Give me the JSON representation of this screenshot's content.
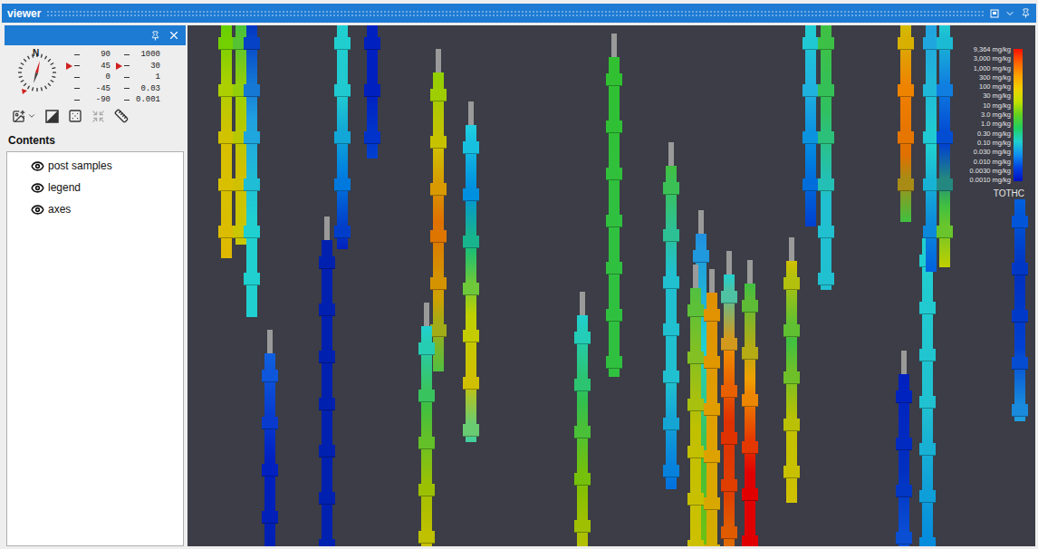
{
  "window": {
    "title": "viewer"
  },
  "panel": {
    "contents_label": "Contents"
  },
  "compass": {
    "north": "N"
  },
  "dip_scale": [
    {
      "label": "90",
      "marker": false
    },
    {
      "label": "45",
      "marker": true
    },
    {
      "label": "0",
      "marker": false
    },
    {
      "label": "-45",
      "marker": false
    },
    {
      "label": "-90",
      "marker": false
    }
  ],
  "value_scale": [
    {
      "label": "1000",
      "marker": false
    },
    {
      "label": "30",
      "marker": true
    },
    {
      "label": "1",
      "marker": false
    },
    {
      "label": "0.03",
      "marker": false
    },
    {
      "label": "0.001",
      "marker": false
    }
  ],
  "contents": [
    {
      "label": "post samples",
      "visible": true
    },
    {
      "label": "legend",
      "visible": true
    },
    {
      "label": "axes",
      "visible": true
    }
  ],
  "legend": {
    "title": "TOTHC",
    "labels": [
      "9,364 mg/kg",
      "3,000 mg/kg",
      "1,000 mg/kg",
      "300 mg/kg",
      "100 mg/kg",
      "30 mg/kg",
      "10 mg/kg",
      "3.0 mg/kg",
      "1.0 mg/kg",
      "0.30 mg/kg",
      "0.10 mg/kg",
      "0.030 mg/kg",
      "0.010 mg/kg",
      "0.0030 mg/kg",
      "0.0010 mg/kg"
    ],
    "colors": [
      "#ff1000",
      "#ff6000",
      "#ffa000",
      "#f0d000",
      "#c0e000",
      "#60d020",
      "#20d060",
      "#20d0d0",
      "#1090f0",
      "#0040e0",
      "#0010c0"
    ]
  },
  "holes": [
    {
      "collar": false,
      "colors": [
        "#5fd000",
        "#a8d000",
        "#d8c000",
        "#d8c000",
        "#e0b800"
      ]
    },
    {
      "collar": false,
      "colors": [
        "#40c040",
        "#a0d000",
        "#d0c000",
        "#c8c800"
      ]
    },
    {
      "collar": false,
      "colors": [
        "#0030c0",
        "#20a0e0",
        "#20d0d0",
        "#20d0d0"
      ]
    },
    {
      "collar": false,
      "colors": [
        "#20d0d0",
        "#20c8d0",
        "#0080e0",
        "#0020c0"
      ]
    },
    {
      "collar": false,
      "colors": [
        "#0020c0",
        "#0020c0",
        "#0040d0"
      ]
    },
    {
      "collar": true,
      "colors": [
        "#0020b0",
        "#0020b0"
      ]
    },
    {
      "collar": true,
      "colors": [
        "#1060e0",
        "#0020c0",
        "#0020b0"
      ]
    },
    {
      "collar": true,
      "colors": [
        "#90d000",
        "#d0c000",
        "#e07000",
        "#d0a000",
        "#50c040"
      ]
    },
    {
      "collar": true,
      "colors": [
        "#20d0e0",
        "#0090e0",
        "#20c070",
        "#c0d000",
        "#d0c000",
        "#40d0a0"
      ]
    },
    {
      "collar": true,
      "colors": [
        "#20d0d0",
        "#40c040",
        "#a0c000",
        "#d8c000"
      ]
    },
    {
      "collar": true,
      "colors": [
        "#30c030",
        "#30c040",
        "#30c040"
      ]
    },
    {
      "collar": true,
      "colors": [
        "#20d0d0",
        "#30c050",
        "#80c000",
        "#c8c000"
      ]
    },
    {
      "collar": true,
      "colors": [
        "#40c040",
        "#20c0d0",
        "#20c0d0",
        "#0070e0"
      ]
    },
    {
      "collar": true,
      "colors": [
        "#2090e0",
        "#20d0d0",
        "#40c040",
        "#80c000"
      ]
    },
    {
      "collar": true,
      "colors": [
        "#50c040",
        "#c0c000",
        "#d0c000"
      ]
    },
    {
      "collar": true,
      "colors": [
        "#e09000",
        "#e0a000",
        "#d0b000"
      ]
    },
    {
      "collar": true,
      "colors": [
        "#20d0d0",
        "#f09000",
        "#e03000",
        "#e04000",
        "#e08000"
      ]
    },
    {
      "collar": true,
      "colors": [
        "#40c040",
        "#f0a000",
        "#e00000",
        "#e00000"
      ]
    },
    {
      "collar": true,
      "colors": [
        "#d0c000",
        "#40c040",
        "#c0c000",
        "#d0c000"
      ]
    },
    {
      "collar": false,
      "colors": [
        "#20d0d0",
        "#20b0e0",
        "#0080e0",
        "#0040d0"
      ]
    },
    {
      "collar": false,
      "colors": [
        "#40c040",
        "#30c060",
        "#20c0d0",
        "#20c0d0"
      ]
    },
    {
      "collar": false,
      "colors": [
        "#d0c000",
        "#f08000",
        "#e07000",
        "#40c040"
      ]
    },
    {
      "collar": true,
      "colors": [
        "#0020c0",
        "#0030c0",
        "#1060e0"
      ]
    },
    {
      "collar": false,
      "colors": [
        "#20d0d0",
        "#20c0d0",
        "#0080e0"
      ]
    },
    {
      "collar": false,
      "colors": [
        "#20a0e0",
        "#20d0d0",
        "#0060e0"
      ]
    },
    {
      "collar": false,
      "colors": [
        "#20d0d0",
        "#1080e0",
        "#0040d0",
        "#40c040",
        "#c0d000"
      ]
    },
    {
      "collar": false,
      "colors": [
        "#0060e0",
        "#0030c0",
        "#0040d0",
        "#20a0e0"
      ]
    }
  ]
}
